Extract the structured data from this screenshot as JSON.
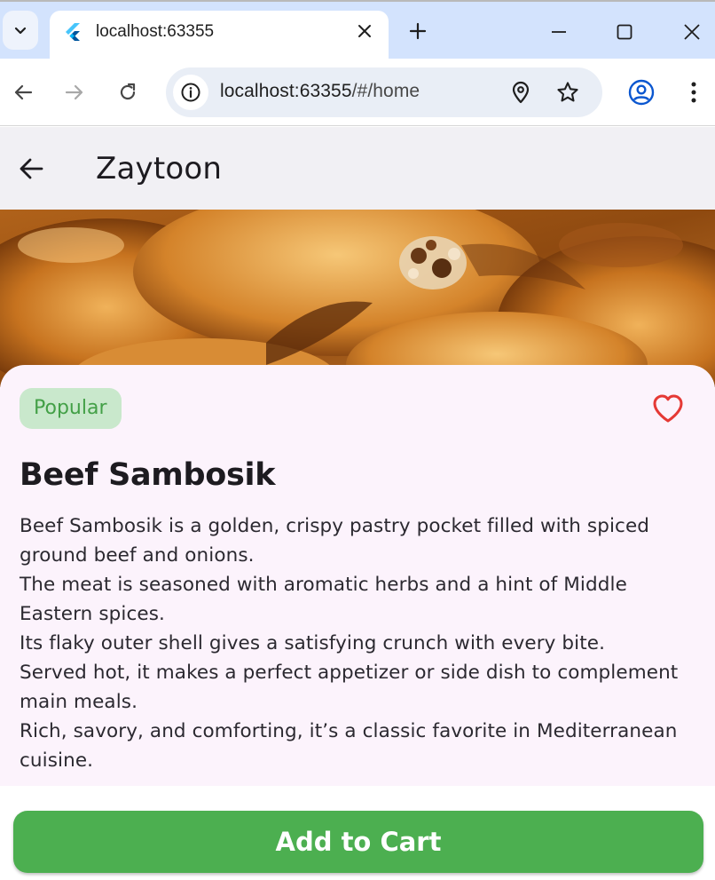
{
  "browser": {
    "tab_title": "localhost:63355",
    "url_host": "localhost:63355",
    "url_path": "/#/home",
    "icons": [
      "tab-list-icon",
      "flutter-favicon",
      "close-icon",
      "plus-icon",
      "minimize-icon",
      "maximize-icon",
      "close-icon",
      "back-arrow-icon",
      "forward-arrow-icon",
      "reload-icon",
      "site-info-icon",
      "location-pin-icon",
      "star-icon",
      "profile-icon",
      "more-vert-icon"
    ]
  },
  "appbar": {
    "title": "Zaytoon",
    "back_icon": "arrow-back-icon"
  },
  "item": {
    "badge": "Popular",
    "name": "Beef Sambosik",
    "description": [
      "Beef Sambosik is a golden, crispy pastry pocket filled with spiced ground beef and onions.",
      "The meat is seasoned with aromatic herbs and a hint of Middle Eastern spices.",
      "Its flaky outer shell gives a satisfying crunch with every bite.",
      "Served hot, it makes a perfect appetizer or side dish to complement main meals.",
      "Rich, savory, and comforting, it’s a classic favorite in Mediterranean cuisine."
    ],
    "favorite_icon": "heart-outline-icon"
  },
  "cart_button": {
    "label": "Add to Cart"
  },
  "colors": {
    "accent_green": "#4caf50",
    "badge_bg": "#c9e8cc",
    "badge_text": "#43a047",
    "heart": "#e53935",
    "card_bg": "#fcf3fc",
    "appbar_bg": "#f1f0f4",
    "chrome_tabstrip": "#d3e3fd"
  }
}
